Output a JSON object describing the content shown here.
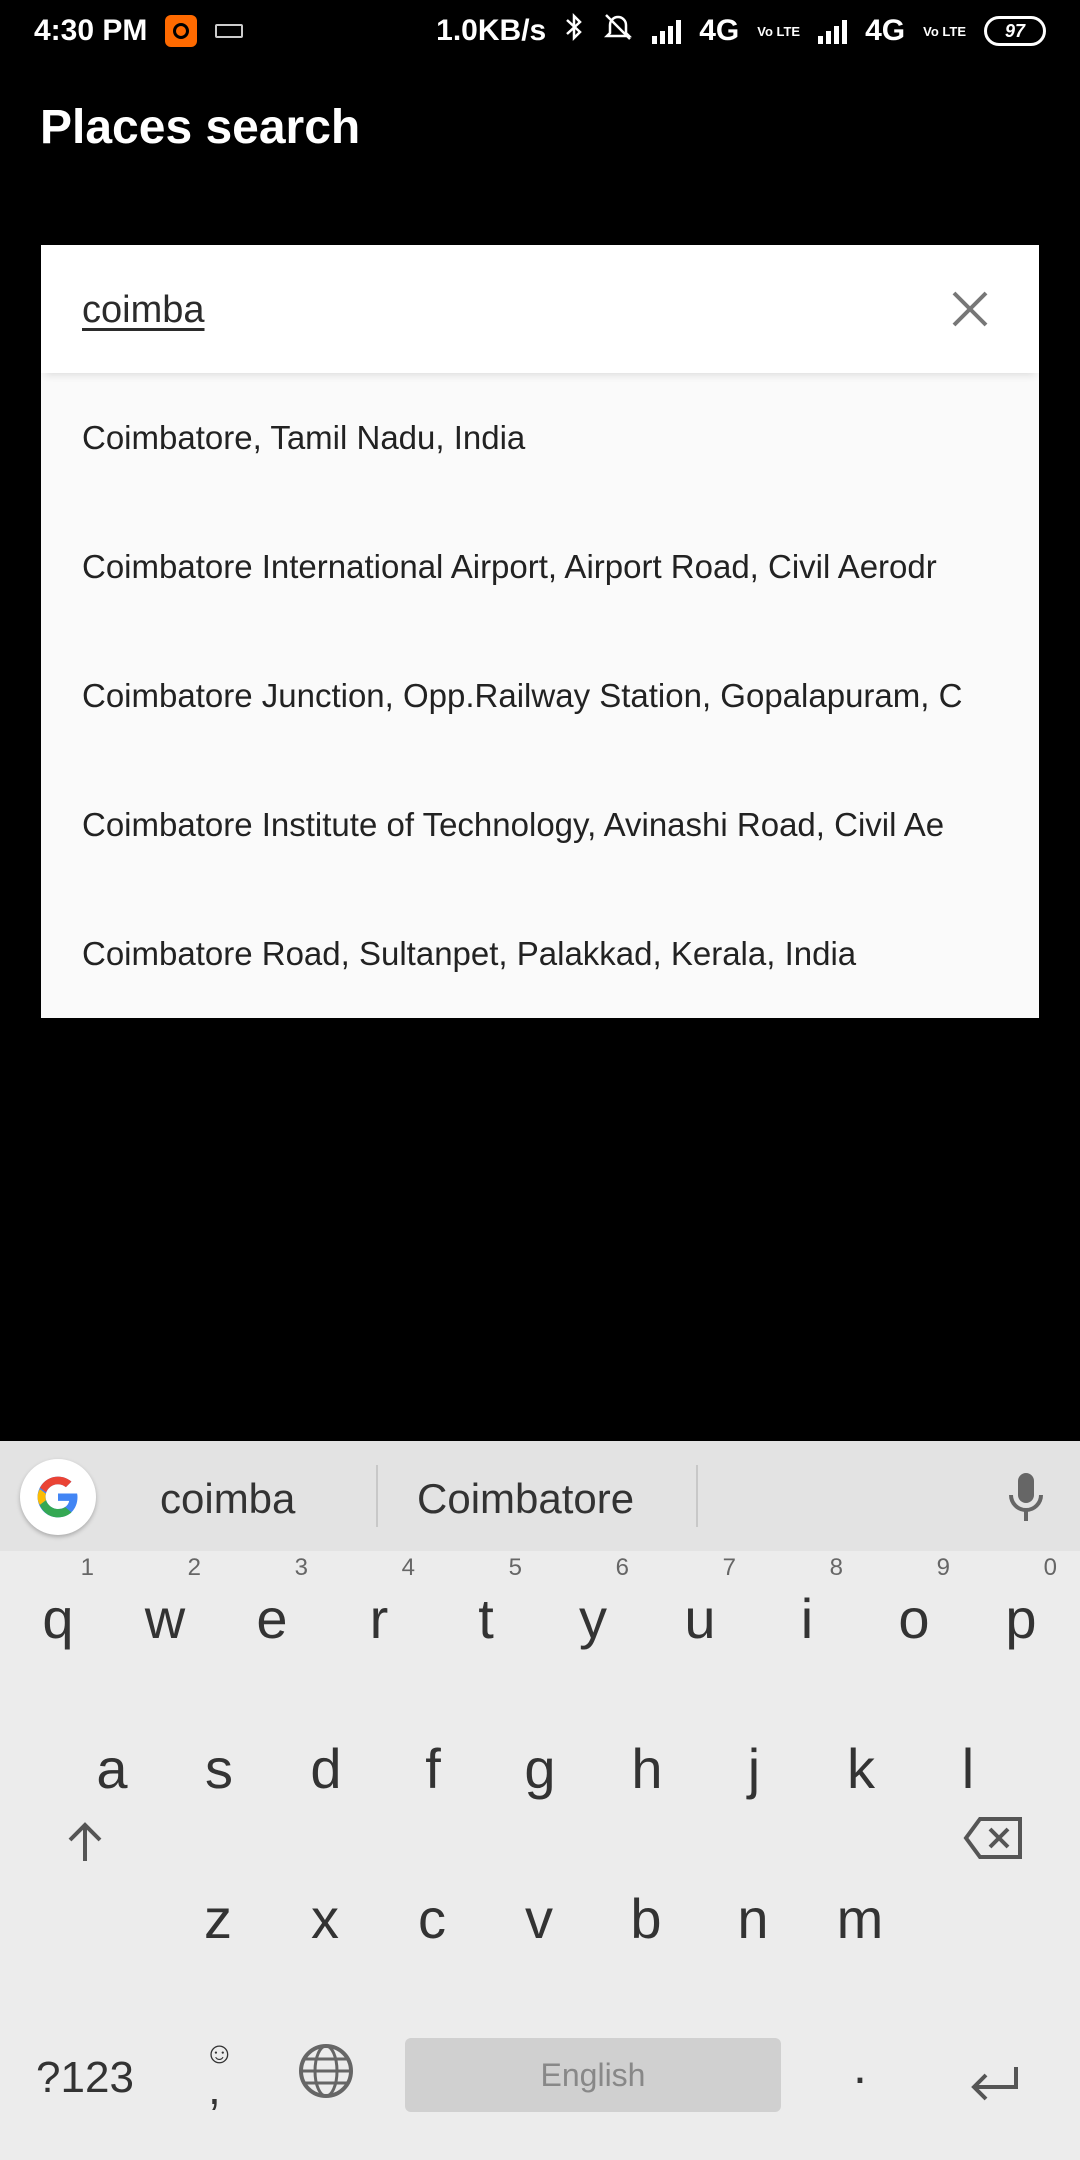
{
  "status_bar": {
    "time": "4:30 PM",
    "speed": "1.0KB/s",
    "network1": "4G",
    "network2": "4G",
    "volte": "Vo LTE",
    "battery": "97"
  },
  "app_bar": {
    "title": "Places search"
  },
  "search": {
    "query": "coimba",
    "suggestions": [
      "Coimbatore, Tamil Nadu, India",
      "Coimbatore International Airport, Airport Road, Civil Aerodr",
      "Coimbatore Junction, Opp.Railway Station, Gopalapuram, C",
      "Coimbatore Institute of Technology, Avinashi Road, Civil Ae",
      "Coimbatore Road, Sultanpet, Palakkad, Kerala, India"
    ]
  },
  "keyboard": {
    "suggestions": [
      "coimba",
      "Coimbatore"
    ],
    "row1": [
      "q",
      "w",
      "e",
      "r",
      "t",
      "y",
      "u",
      "i",
      "o",
      "p"
    ],
    "row1_hints": [
      "1",
      "2",
      "3",
      "4",
      "5",
      "6",
      "7",
      "8",
      "9",
      "0"
    ],
    "row2": [
      "a",
      "s",
      "d",
      "f",
      "g",
      "h",
      "j",
      "k",
      "l"
    ],
    "row3": [
      "z",
      "x",
      "c",
      "v",
      "b",
      "n",
      "m"
    ],
    "symbols_key": "?123",
    "comma_key": ",",
    "space_label": "English",
    "period_key": "."
  }
}
